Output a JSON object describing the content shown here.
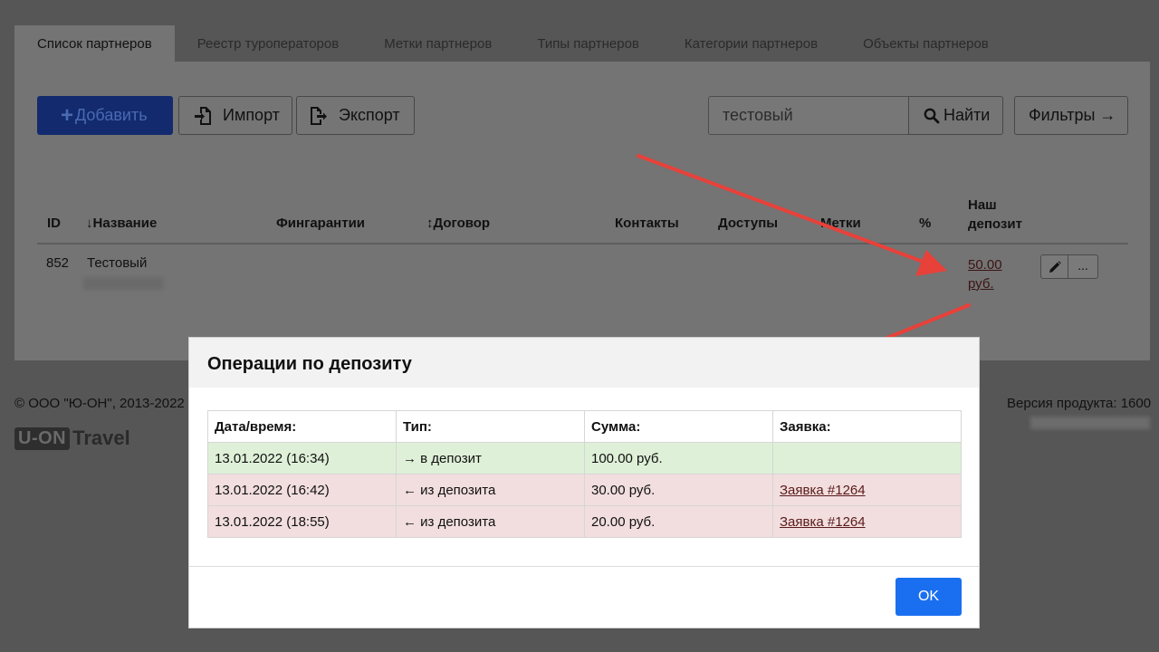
{
  "tabs": [
    {
      "label": "Список партнеров",
      "active": true
    },
    {
      "label": "Реестр туроператоров"
    },
    {
      "label": "Метки партнеров"
    },
    {
      "label": "Типы партнеров"
    },
    {
      "label": "Категории партнеров"
    },
    {
      "label": "Объекты партнеров"
    }
  ],
  "toolbar": {
    "add_label": "Добавить",
    "import_label": "Импорт",
    "export_label": "Экспорт",
    "search_value": "тестовый",
    "find_label": "Найти",
    "filters_label": "Фильтры →"
  },
  "table": {
    "headers": {
      "id": "ID",
      "name": "↓Название",
      "guarantees": "Фингарантии",
      "contract": "↕Договор",
      "contacts": "Контакты",
      "access": "Доступы",
      "tags": "Метки",
      "percent": "%",
      "deposit": "Наш депозит"
    },
    "row": {
      "id": "852",
      "name": "Тестовый",
      "deposit": "50.00 руб.",
      "more": "..."
    }
  },
  "footer": {
    "copyright": "© ООО \"Ю-ОН\", 2013-2022",
    "version": "Версия продукта: 1600",
    "logo_box": "U-ON",
    "logo_text": "Travel"
  },
  "modal": {
    "title": "Операции по депозиту",
    "headers": [
      "Дата/время:",
      "Тип:",
      "Сумма:",
      "Заявка:"
    ],
    "rows": [
      {
        "date": "13.01.2022 (16:34)",
        "type": "→ в депозит",
        "amount": "100.00 руб.",
        "order": ""
      },
      {
        "date": "13.01.2022 (16:42)",
        "type": "← из депозита",
        "amount": "30.00 руб.",
        "order": "Заявка #1264"
      },
      {
        "date": "13.01.2022 (18:55)",
        "type": "← из депозита",
        "amount": "20.00 руб.",
        "order": "Заявка #1264"
      }
    ],
    "ok_label": "OK"
  },
  "colors": {
    "overlay_bg": "#565656",
    "panel_bg": "#747474",
    "row_in": "#dff0d8",
    "row_out": "#f2dede",
    "ok_button": "#1a6ff0",
    "arrow": "#e8413a"
  }
}
